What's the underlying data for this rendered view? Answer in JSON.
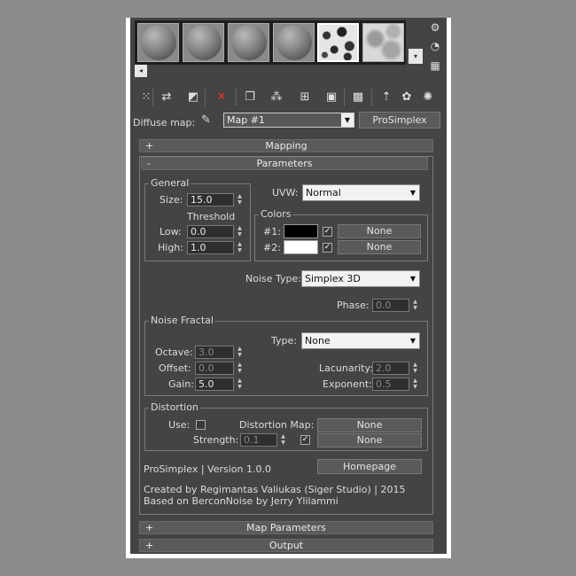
{
  "slots": [
    "sphere",
    "sphere",
    "sphere",
    "sphere",
    "noise-fine",
    "noise-soft"
  ],
  "scroll_left": "◂",
  "scroll_down": "▾",
  "toolbar_icons": [
    "get-material-icon",
    "put-to-scene-icon",
    "assign-to-selection-icon",
    "reset-icon",
    "copy-material-icon",
    "make-unique-icon",
    "put-to-library-icon",
    "material-id-icon",
    "show-in-viewport-icon",
    "show-end-result-icon",
    "go-to-parent-icon",
    "go-forward-icon"
  ],
  "diffuse": {
    "label": "Diffuse map:",
    "map_name": "Map #1",
    "type_button": "ProSimplex"
  },
  "rollouts": {
    "mapping": "Mapping",
    "parameters": "Parameters",
    "map_parameters": "Map Parameters",
    "output": "Output",
    "plus": "+",
    "minus": "-"
  },
  "general": {
    "title": "General",
    "size_label": "Size:",
    "size": "15.0",
    "threshold_label": "Threshold",
    "low_label": "Low:",
    "low": "0.0",
    "high_label": "High:",
    "high": "1.0"
  },
  "uvw": {
    "label": "UVW:",
    "value": "Normal"
  },
  "colors": {
    "title": "Colors",
    "c1_label": "#1:",
    "c1_color": "#000000",
    "c1_map": "None",
    "c2_label": "#2:",
    "c2_color": "#ffffff",
    "c2_map": "None",
    "check": "✓"
  },
  "noise_type": {
    "label": "Noise Type:",
    "value": "Simplex 3D"
  },
  "phase": {
    "label": "Phase:",
    "value": "0.0"
  },
  "fractal": {
    "title": "Noise Fractal",
    "type_label": "Type:",
    "type": "None",
    "octave_label": "Octave:",
    "octave": "3.0",
    "offset_label": "Offset:",
    "offset": "0.0",
    "gain_label": "Gain:",
    "gain": "5.0",
    "lacunarity_label": "Lacunarity:",
    "lacunarity": "2.0",
    "exponent_label": "Exponent:",
    "exponent": "0.5"
  },
  "distortion": {
    "title": "Distortion",
    "use_label": "Use:",
    "map_label": "Distortion Map:",
    "map": "None",
    "strength_label": "Strength:",
    "strength": "0.1",
    "strength_map": "None",
    "check": "✓"
  },
  "about": {
    "version": "ProSimplex | Version 1.0.0",
    "homepage": "Homepage",
    "credit1": "Created by Regimantas Valiukas (Siger Studio) | 2015",
    "credit2": "Based on BerconNoise by Jerry Ylilammi"
  }
}
